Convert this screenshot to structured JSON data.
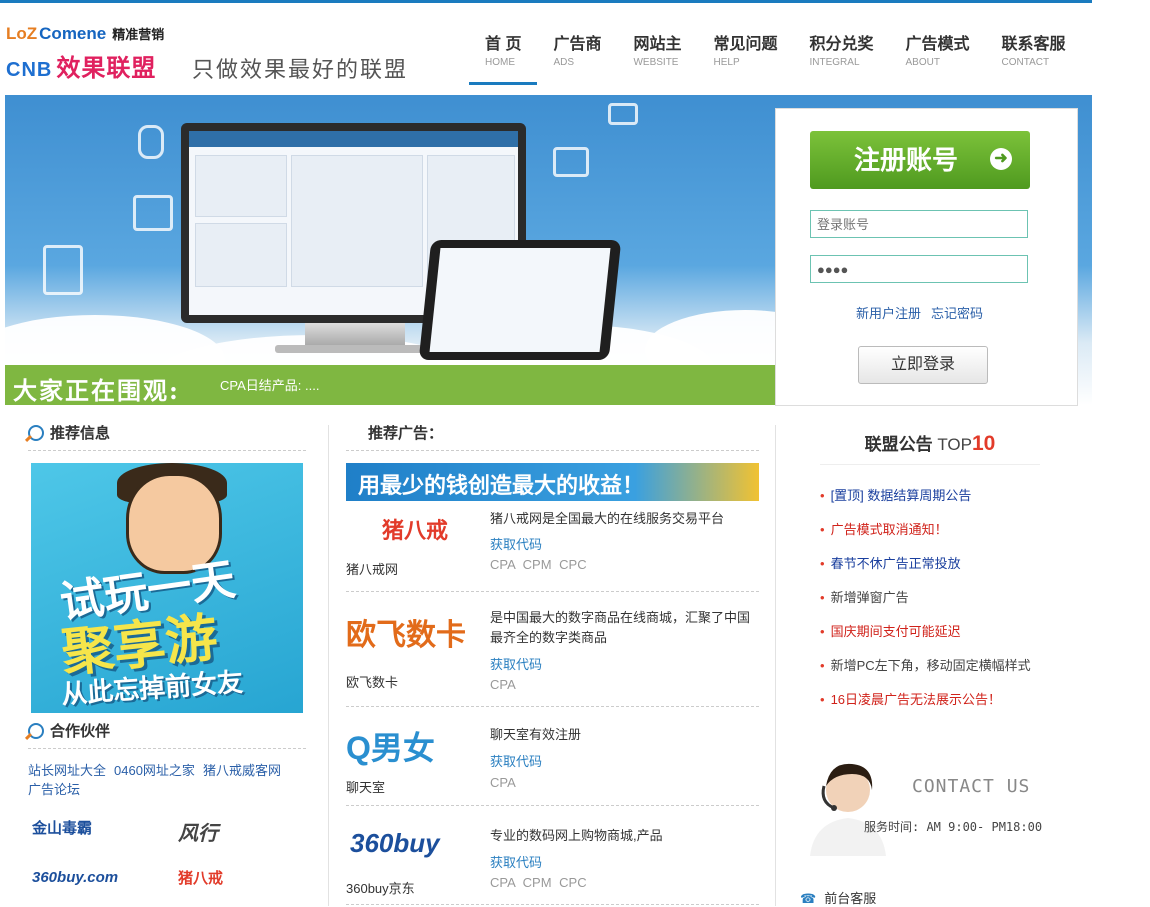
{
  "header": {
    "brand_loz": "LoZ",
    "brand_name": "Comene",
    "brand_tag": "精准营销",
    "brand_cnb": "CNB",
    "brand_cn": "效果联盟",
    "slogan": "只做效果最好的联盟"
  },
  "nav": [
    {
      "cn": "首 页",
      "en": "HOME",
      "active": true
    },
    {
      "cn": "广告商",
      "en": "ADS"
    },
    {
      "cn": "网站主",
      "en": "WEBSITE"
    },
    {
      "cn": "常见问题",
      "en": "HELP"
    },
    {
      "cn": "积分兑奖",
      "en": "INTEGRAL"
    },
    {
      "cn": "广告模式",
      "en": "ABOUT"
    },
    {
      "cn": "联系客服",
      "en": "CONTACT"
    }
  ],
  "banner": {
    "news_title": "大家正在围观:",
    "news_text": "CPA日结产品: ...."
  },
  "login": {
    "register_label": "注册账号",
    "username_placeholder": "登录账号",
    "password_value": "●●●●",
    "new_user": "新用户注册",
    "forgot": "忘记密码",
    "login_label": "立即登录"
  },
  "left": {
    "recommend_title": "推荐信息",
    "promo_l1": "试玩一天",
    "promo_l2": "聚享游",
    "promo_l3": "从此忘掉前女友",
    "partners_title": "合作伙伴",
    "partner_links": [
      "站长网址大全",
      "0460网址之家",
      "猪八戒威客网",
      "广告论坛"
    ],
    "partner_logos": [
      "金山毒霸",
      "风行",
      "360buy.com",
      "猪八戒"
    ]
  },
  "middle": {
    "title": "推荐广告：",
    "banner_text": "用最少的钱创造最大的收益！",
    "ads": [
      {
        "logo": "猪八戒",
        "name": "猪八戒网",
        "desc": "猪八戒网是全国最大的在线服务交易平台",
        "code": "获取代码",
        "modes": "CPA  CPM  CPC"
      },
      {
        "logo": "欧飞数卡",
        "name": "欧飞数卡",
        "desc": "是中国最大的数字商品在线商城，汇聚了中国最齐全的数字类商品",
        "code": "获取代码",
        "modes": "CPA"
      },
      {
        "logo": "Q男女",
        "name": "聊天室",
        "desc": "聊天室有效注册",
        "code": "获取代码",
        "modes": "CPA"
      },
      {
        "logo": "360buy",
        "name": "360buy京东",
        "desc": "专业的数码网上购物商城,产品",
        "code": "获取代码",
        "modes": "CPA  CPM  CPC"
      }
    ]
  },
  "right": {
    "title": "联盟公告",
    "title_top": "TOP",
    "title_ten": "10",
    "notices": [
      {
        "text": "[置顶] 数据结算周期公告",
        "color": "#1a3f9e"
      },
      {
        "text": "广告模式取消通知！",
        "color": "#d0221a"
      },
      {
        "text": "春节不休广告正常投放",
        "color": "#1a3f9e"
      },
      {
        "text": "新增弹窗广告",
        "color": "#444444"
      },
      {
        "text": "国庆期间支付可能延迟",
        "color": "#d0221a"
      },
      {
        "text": "新增PC左下角，移动固定横幅样式",
        "color": "#444444"
      },
      {
        "text": "16日凌晨广告无法展示公告！",
        "color": "#d0221a"
      }
    ],
    "contact_us": "CONTACT US",
    "hours": "服务时间: AM 9:00- PM18:00",
    "service": "前台客服"
  },
  "colors": {
    "accent": "#1a7bbf",
    "green": "#7fb741",
    "red": "#e23b2a"
  }
}
